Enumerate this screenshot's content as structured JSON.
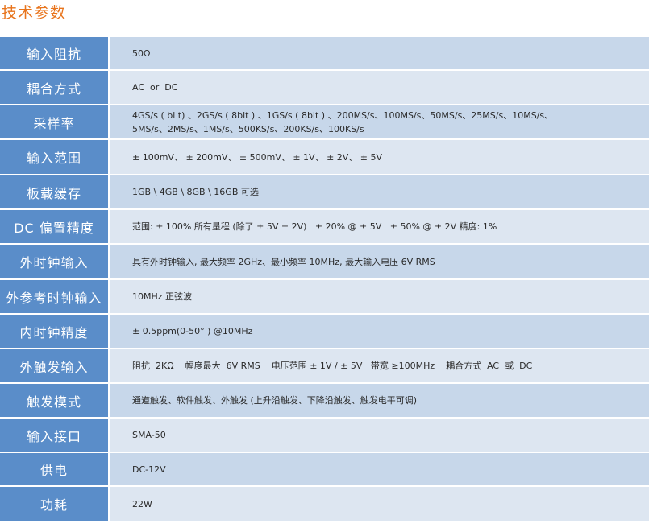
{
  "title": "技术参数",
  "rows": [
    {
      "label": "输入阻抗",
      "value": "50Ω"
    },
    {
      "label": "耦合方式",
      "value": "AC  or  DC"
    },
    {
      "label": "采样率",
      "value": "4GS/s ( bi t) 、2GS/s ( 8bit ) 、1GS/s ( 8bit ) 、200MS/s、100MS/s、50MS/s、25MS/s、10MS/s、\n5MS/s、2MS/s、1MS/s、500KS/s、200KS/s、100KS/s"
    },
    {
      "label": "输入范围",
      "value": "± 100mV、 ± 200mV、 ± 500mV、 ± 1V、 ± 2V、 ± 5V"
    },
    {
      "label": "板载缓存",
      "value": "1GB \\ 4GB \\ 8GB \\ 16GB 可选"
    },
    {
      "label": "DC 偏置精度",
      "value": "范围: ± 100% 所有量程 (除了 ± 5V ± 2V)   ± 20% @ ± 5V   ± 50% @ ± 2V 精度: 1%"
    },
    {
      "label": "外时钟输入",
      "value": "具有外时钟输入, 最大频率 2GHz、最小频率 10MHz, 最大输入电压 6V RMS"
    },
    {
      "label": "外参考时钟输入",
      "value": "10MHz 正弦波"
    },
    {
      "label": "内时钟精度",
      "value": "± 0.5ppm(0-50° ) @10MHz"
    },
    {
      "label": "外触发输入",
      "value": "阻抗  2KΩ    幅度最大  6V RMS    电压范围 ± 1V / ± 5V   带宽 ≥100MHz    耦合方式  AC  或  DC"
    },
    {
      "label": "触发模式",
      "value": "通道触发、软件触发、外触发 (上升沿触发、下降沿触发、触发电平可调)"
    },
    {
      "label": "输入接口",
      "value": "SMA-50"
    },
    {
      "label": "供电",
      "value": "DC-12V"
    },
    {
      "label": "功耗",
      "value": "22W"
    }
  ]
}
